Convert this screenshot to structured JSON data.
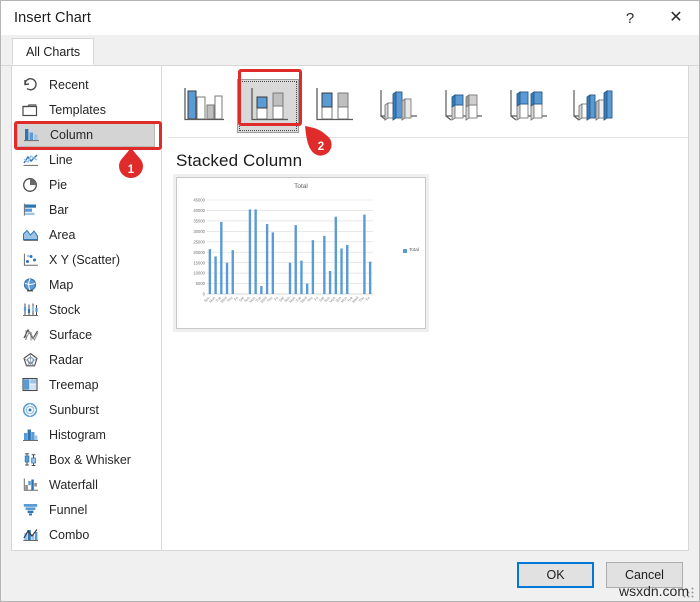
{
  "window": {
    "title": "Insert Chart",
    "help_label": "?",
    "help_icon": "question-mark-icon",
    "close_label": "✕",
    "close_icon": "close-icon"
  },
  "tabs": [
    {
      "label": "All Charts",
      "selected": true
    }
  ],
  "sidebar": {
    "items": [
      {
        "label": "Recent",
        "icon": "recent-clock-icon",
        "selected": false
      },
      {
        "label": "Templates",
        "icon": "folder-icon",
        "selected": false
      },
      {
        "label": "Column",
        "icon": "column-chart-icon",
        "selected": true
      },
      {
        "label": "Line",
        "icon": "line-chart-icon",
        "selected": false
      },
      {
        "label": "Pie",
        "icon": "pie-chart-icon",
        "selected": false
      },
      {
        "label": "Bar",
        "icon": "bar-chart-icon",
        "selected": false
      },
      {
        "label": "Area",
        "icon": "area-chart-icon",
        "selected": false
      },
      {
        "label": "X Y (Scatter)",
        "icon": "scatter-chart-icon",
        "selected": false
      },
      {
        "label": "Map",
        "icon": "map-globe-icon",
        "selected": false
      },
      {
        "label": "Stock",
        "icon": "stock-chart-icon",
        "selected": false
      },
      {
        "label": "Surface",
        "icon": "surface-chart-icon",
        "selected": false
      },
      {
        "label": "Radar",
        "icon": "radar-chart-icon",
        "selected": false
      },
      {
        "label": "Treemap",
        "icon": "treemap-chart-icon",
        "selected": false
      },
      {
        "label": "Sunburst",
        "icon": "sunburst-chart-icon",
        "selected": false
      },
      {
        "label": "Histogram",
        "icon": "histogram-icon",
        "selected": false
      },
      {
        "label": "Box & Whisker",
        "icon": "box-whisker-icon",
        "selected": false
      },
      {
        "label": "Waterfall",
        "icon": "waterfall-icon",
        "selected": false
      },
      {
        "label": "Funnel",
        "icon": "funnel-icon",
        "selected": false
      },
      {
        "label": "Combo",
        "icon": "combo-chart-icon",
        "selected": false
      }
    ]
  },
  "gallery": {
    "thumbnails": [
      {
        "name": "Clustered Column",
        "icon": "clustered-column-icon",
        "selected": false
      },
      {
        "name": "Stacked Column",
        "icon": "stacked-column-icon",
        "selected": true
      },
      {
        "name": "100% Stacked Column",
        "icon": "100-stacked-column-icon",
        "selected": false
      },
      {
        "name": "3-D Clustered Column",
        "icon": "3d-clustered-column-icon",
        "selected": false
      },
      {
        "name": "3-D Stacked Column",
        "icon": "3d-stacked-column-icon",
        "selected": false
      },
      {
        "name": "3-D 100% Stacked Column",
        "icon": "3d-100-stacked-column-icon",
        "selected": false
      },
      {
        "name": "3-D Column",
        "icon": "3d-column-icon",
        "selected": false
      }
    ]
  },
  "preview": {
    "heading": "Stacked Column"
  },
  "chart_data": {
    "type": "bar",
    "title": "Total",
    "xlabel": "",
    "ylabel": "",
    "ylim": [
      0,
      45000
    ],
    "yticks": [
      0,
      5000,
      10000,
      15000,
      20000,
      25000,
      30000,
      35000,
      40000,
      45000
    ],
    "ytick_labels": [
      "0",
      "5000",
      "10000",
      "15000",
      "20000",
      "25000",
      "30000",
      "35000",
      "40000",
      "45000"
    ],
    "grid": true,
    "legend": [
      "Total"
    ],
    "legend_position": "right",
    "series_color": "#5b9bd5",
    "categories": [
      "Sun",
      "Mon",
      "Tue",
      "Wed",
      "Thu",
      "Fri",
      "Sat",
      "Sun",
      "Mon",
      "Tue",
      "Wed",
      "Thu",
      "Fri",
      "Sat",
      "Sun",
      "Mon",
      "Tue",
      "Wed",
      "Thu",
      "Fri",
      "Sat",
      "Sun",
      "Mon"
    ],
    "values": [
      21500,
      18000,
      34500,
      15000,
      21000,
      0,
      0,
      40500,
      40500,
      3800,
      33500,
      29500,
      0,
      0,
      15000,
      33000,
      16000,
      5000,
      25800,
      0,
      27800,
      11000,
      37000
    ]
  },
  "extra_bars": {
    "values": [
      21800,
      23500,
      0,
      0,
      38000,
      15500
    ]
  },
  "footer": {
    "ok_label": "OK",
    "cancel_label": "Cancel",
    "resize_grip_icon": "resize-grip-icon"
  },
  "annotations": {
    "badges": [
      {
        "number": "1",
        "target": "sidebar-item-column"
      },
      {
        "number": "2",
        "target": "thumbnail-stacked-column"
      }
    ],
    "color": "#e02b2b"
  },
  "watermark": {
    "text": "wsxdn.com"
  }
}
